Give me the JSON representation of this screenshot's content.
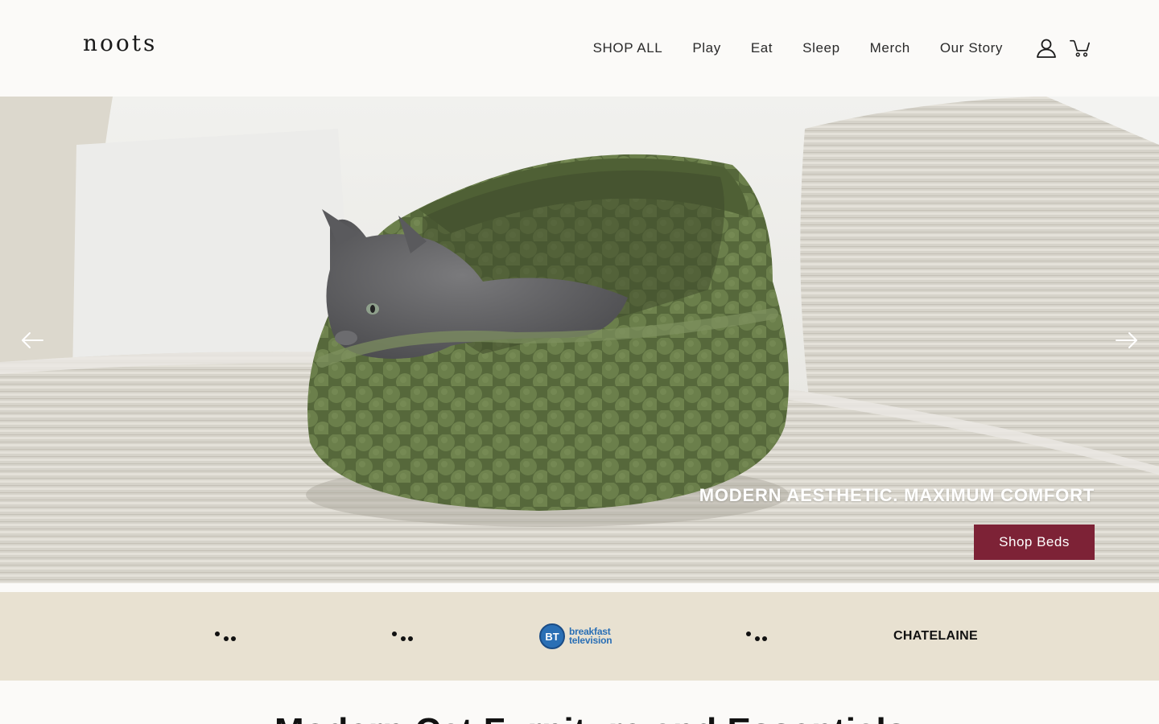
{
  "header": {
    "logo": "noots",
    "nav": [
      {
        "label": "SHOP ALL"
      },
      {
        "label": "Play"
      },
      {
        "label": "Eat"
      },
      {
        "label": "Sleep"
      },
      {
        "label": "Merch"
      },
      {
        "label": "Our Story"
      }
    ],
    "icons": [
      "account-icon",
      "cart-icon"
    ]
  },
  "hero": {
    "heading": "MODERN AESTHETIC. MAXIMUM COMFORT",
    "cta_label": "Shop Beds",
    "cta_color": "#7d2236",
    "prev_icon": "arrow-left-icon",
    "next_icon": "arrow-right-icon"
  },
  "press": {
    "background": "#e8e1d1",
    "logos": [
      {
        "type": "dots"
      },
      {
        "type": "dots"
      },
      {
        "type": "bt",
        "badge": "BT",
        "line1": "breakfast",
        "line2": "television"
      },
      {
        "type": "dots"
      },
      {
        "type": "text",
        "text": "CHATELAINE"
      }
    ]
  },
  "section": {
    "title": "Modern Cat Furniture and Essentials"
  }
}
